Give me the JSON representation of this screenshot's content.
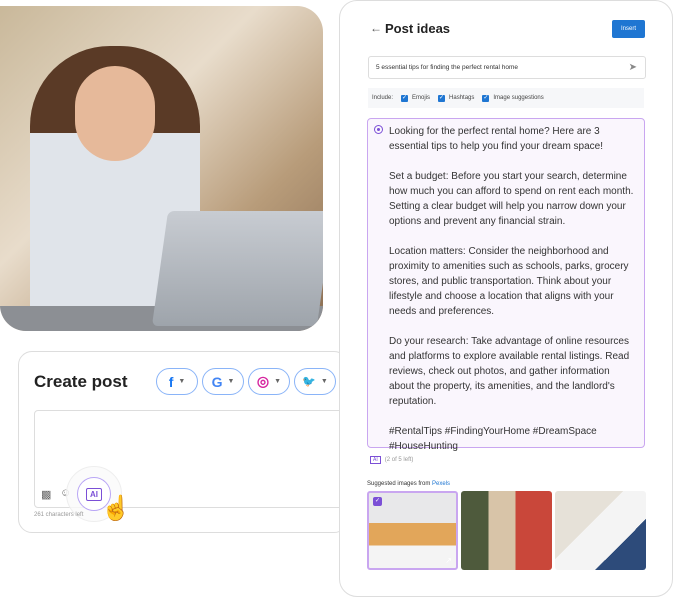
{
  "create_post": {
    "title": "Create post",
    "channels": [
      {
        "name": "facebook",
        "glyph": "f",
        "color": "#1877f2"
      },
      {
        "name": "google",
        "glyph": "G",
        "color": "#4285f4"
      },
      {
        "name": "instagram",
        "glyph": "◎",
        "color": "#d6249f"
      },
      {
        "name": "twitter",
        "glyph": "🐦",
        "color": "#1da1f2"
      }
    ],
    "chars_left": "261 characters left",
    "ai_label": "AI"
  },
  "post_ideas": {
    "title": "Post ideas",
    "back_icon": "arrow-left-icon",
    "insert_label": "Insert",
    "prompt_value": "5 essential tips for finding the perfect rental home",
    "include_label": "Include:",
    "options": [
      {
        "label": "Emojis",
        "checked": true
      },
      {
        "label": "Hashtags",
        "checked": true
      },
      {
        "label": "Image suggestions",
        "checked": true
      }
    ],
    "result_paragraphs": [
      "Looking for the perfect rental home? Here are 3 essential tips to help you find your dream space!",
      "Set a budget: Before you start your search, determine how much you can afford to spend on rent each month. Setting a clear budget will help you narrow down your options and prevent any financial strain.",
      "Location matters: Consider the neighborhood and proximity to amenities such as schools, parks, grocery stores, and public transportation. Think about your lifestyle and choose a location that aligns with your needs and preferences.",
      "Do your research: Take advantage of online resources and platforms to explore available rental listings. Read reviews, check out photos, and gather information about the property, its amenities, and the landlord's reputation.",
      "#RentalTips #FindingYourHome #DreamSpace #HouseHunting"
    ],
    "ai_badge": "AI",
    "remaining": "(2 of 5 left)",
    "suggested_prefix": "Suggested images from",
    "suggested_source": "Pexels",
    "accent": "#7b4fd6",
    "primary": "#1f76d2"
  }
}
